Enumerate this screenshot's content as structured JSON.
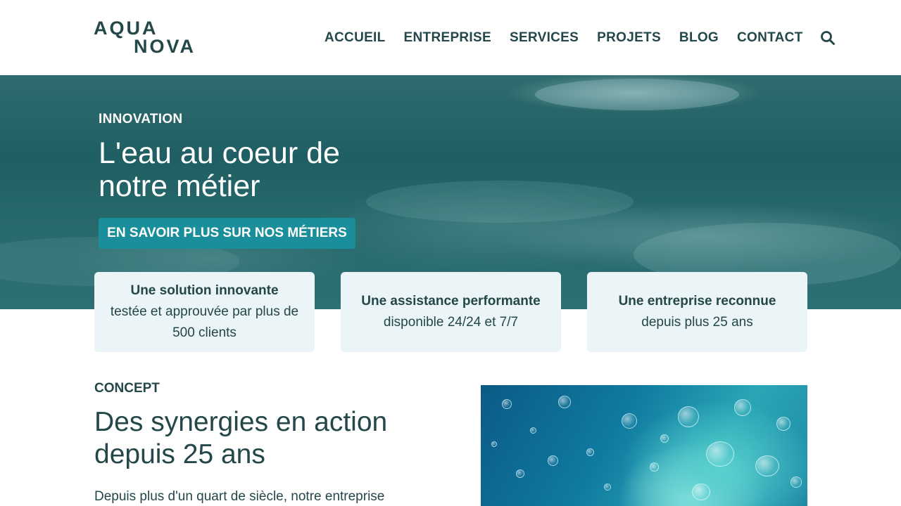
{
  "logo": {
    "line1": "AQUA",
    "line2": "NOVA"
  },
  "nav": {
    "items": [
      {
        "label": "ACCUEIL"
      },
      {
        "label": "ENTREPRISE"
      },
      {
        "label": "SERVICES"
      },
      {
        "label": "PROJETS"
      },
      {
        "label": "BLOG"
      },
      {
        "label": "CONTACT"
      }
    ],
    "search_icon": "search-icon"
  },
  "hero": {
    "eyebrow": "INNOVATION",
    "title": "L'eau au coeur de notre métier",
    "cta_label": "EN SAVOIR PLUS SUR NOS MÉTIERS"
  },
  "features": [
    {
      "title": "Une solution innovante",
      "description": "testée et approuvée par plus de 500 clients"
    },
    {
      "title": "Une assistance performante",
      "description": "disponible 24/24 et 7/7"
    },
    {
      "title": "Une entreprise reconnue",
      "description": "depuis plus 25 ans"
    }
  ],
  "concept": {
    "eyebrow": "CONCEPT",
    "title": "Des synergies en action depuis 25 ans",
    "body": "Depuis plus d'un quart de siècle, notre entreprise"
  },
  "colors": {
    "primary_text": "#24474a",
    "accent": "#1a8e9a",
    "card_bg": "#ebf4f7"
  }
}
